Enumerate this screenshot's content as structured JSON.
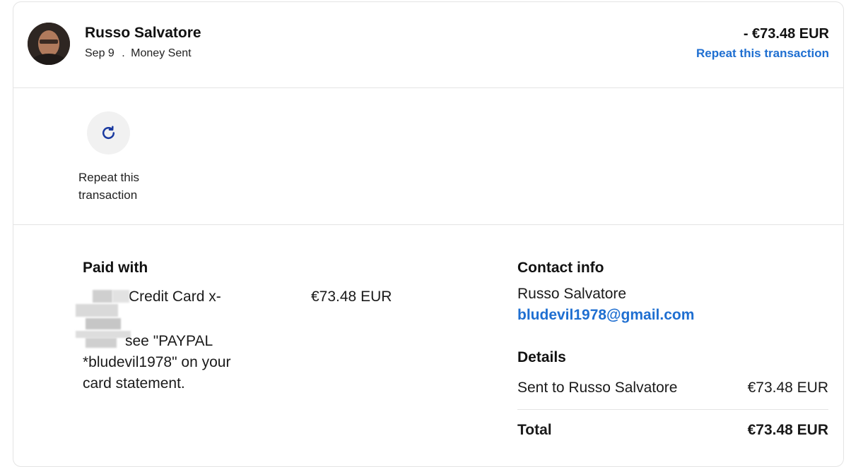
{
  "header": {
    "name": "Russo Salvatore",
    "date": "Sep 9",
    "separator": ".",
    "type": "Money Sent",
    "amount": "- €73.48 EUR",
    "repeat_link": "Repeat this transaction"
  },
  "actions": {
    "repeat_icon": "refresh-icon",
    "repeat_label": "Repeat this transaction"
  },
  "paid_with": {
    "title": "Paid with",
    "card_line": "Credit Card x-",
    "note": "see \"PAYPAL *bludevil1978\" on your card statement.",
    "amount": "€73.48 EUR"
  },
  "contact": {
    "title": "Contact info",
    "name": "Russo Salvatore",
    "email": "bludevil1978@gmail.com"
  },
  "details": {
    "title": "Details",
    "sent_label": "Sent to Russo Salvatore",
    "sent_amount": "€73.48 EUR",
    "total_label": "Total",
    "total_amount": "€73.48 EUR"
  },
  "colors": {
    "link": "#1f6fd1",
    "icon": "#1a3aa0",
    "divider": "#e4e4e4"
  }
}
